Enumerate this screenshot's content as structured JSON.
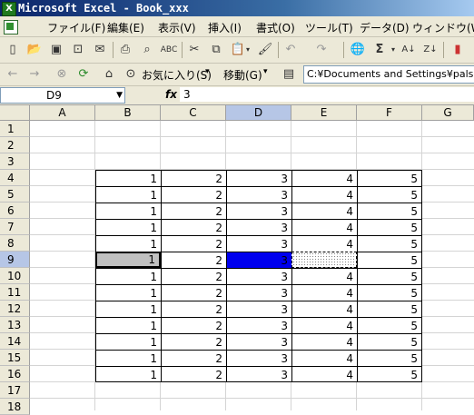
{
  "window": {
    "title": "Microsoft Excel - Book_xxx"
  },
  "menu": [
    "ファイル(F)",
    "編集(E)",
    "表示(V)",
    "挿入(I)",
    "書式(O)",
    "ツール(T)",
    "データ(D)",
    "ウィンドウ(W)"
  ],
  "toolbar2": {
    "favorites": "お気に入り(S)",
    "move": "移動(G)",
    "address": "C:¥Documents and Settings¥palsatio"
  },
  "formula_bar": {
    "name_box": "D9",
    "fx": "fx",
    "value": "3"
  },
  "columns": [
    "A",
    "B",
    "C",
    "D",
    "E",
    "F",
    "G"
  ],
  "rows": [
    "1",
    "2",
    "3",
    "4",
    "5",
    "6",
    "7",
    "8",
    "9",
    "10",
    "11",
    "12",
    "13",
    "14",
    "15",
    "16",
    "17",
    "18"
  ],
  "table": {
    "values": [
      [
        "1",
        "2",
        "3",
        "4",
        "5"
      ],
      [
        "1",
        "2",
        "3",
        "4",
        "5"
      ],
      [
        "1",
        "2",
        "3",
        "4",
        "5"
      ],
      [
        "1",
        "2",
        "3",
        "4",
        "5"
      ],
      [
        "1",
        "2",
        "3",
        "4",
        "5"
      ],
      [
        "1",
        "2",
        "3",
        "",
        "5"
      ],
      [
        "1",
        "2",
        "3",
        "4",
        "5"
      ],
      [
        "1",
        "2",
        "3",
        "4",
        "5"
      ],
      [
        "1",
        "2",
        "3",
        "4",
        "5"
      ],
      [
        "1",
        "2",
        "3",
        "4",
        "5"
      ],
      [
        "1",
        "2",
        "3",
        "4",
        "5"
      ],
      [
        "1",
        "2",
        "3",
        "4",
        "5"
      ],
      [
        "1",
        "2",
        "3",
        "4",
        "5"
      ]
    ]
  },
  "colors": {
    "selection": "#0000ee",
    "title_bar": "#0a246a",
    "chrome": "#ece9d8"
  }
}
